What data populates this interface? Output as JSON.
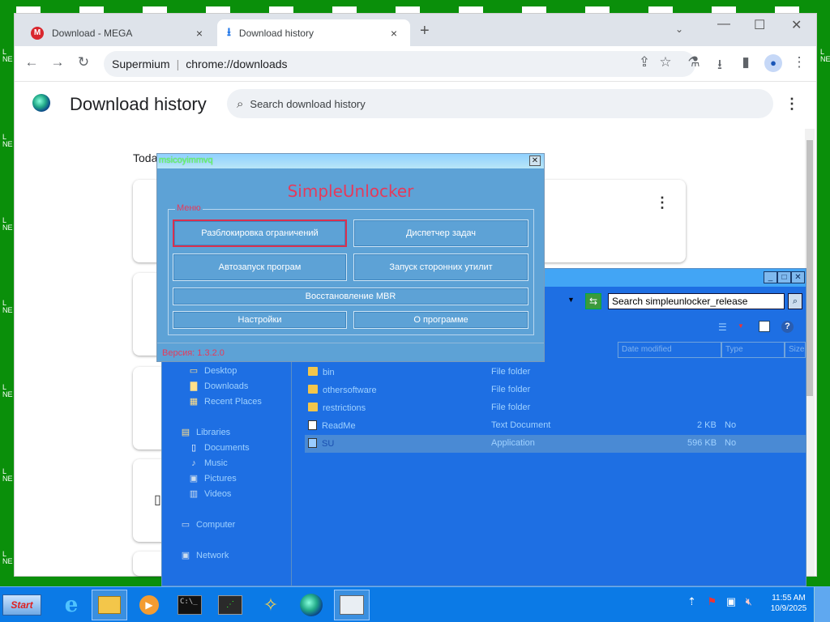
{
  "browser": {
    "tabs": [
      {
        "title": "Download - MEGA",
        "favicon": "mega-icon",
        "active": false
      },
      {
        "title": "Download history",
        "favicon": "download-icon",
        "active": true
      }
    ],
    "new_tab_symbol": "+",
    "tab_close_symbol": "×",
    "omnibox": {
      "site": "Supermium",
      "url": "chrome://downloads"
    },
    "window_controls": [
      "—",
      "☐",
      "✕"
    ]
  },
  "downloads_page": {
    "title": "Download history",
    "search_placeholder": "Search download history",
    "date_group": "Toda",
    "cards_count": 5
  },
  "simpleunlocker": {
    "window_title": "msicoyimmvq",
    "app_title": "SimpleUnlocker",
    "group_label": "Меню",
    "buttons": {
      "unlock_restrictions": "Разблокировка ограничений",
      "task_manager": "Диспетчер задач",
      "autorun": "Автозапуск програм",
      "third_party": "Запуск сторонних утилит",
      "mbr_restore": "Восстановление MBR",
      "settings": "Настройки",
      "about": "О программе"
    },
    "version": "Версия: 1.3.2.0"
  },
  "explorer": {
    "search_text": "Search simpleunlocker_release",
    "columns": [
      "Date modified",
      "Type",
      "Size"
    ],
    "nav": {
      "desktop": "Desktop",
      "downloads": "Downloads",
      "recent": "Recent Places",
      "libraries": "Libraries",
      "documents": "Documents",
      "music": "Music",
      "pictures": "Pictures",
      "videos": "Videos",
      "computer": "Computer",
      "network": "Network"
    },
    "files": [
      {
        "name": "bin",
        "type": "File folder",
        "size": "",
        "extra": "",
        "icon": "folder"
      },
      {
        "name": "othersoftware",
        "type": "File folder",
        "size": "",
        "extra": "",
        "icon": "folder"
      },
      {
        "name": "restrictions",
        "type": "File folder",
        "size": "",
        "extra": "",
        "icon": "folder"
      },
      {
        "name": "ReadMe",
        "type": "Text Document",
        "size": "2 KB",
        "extra": "No",
        "icon": "doc"
      },
      {
        "name": "SU",
        "type": "Application",
        "size": "596 KB",
        "extra": "No",
        "icon": "app"
      }
    ]
  },
  "taskbar": {
    "start_label": "Start",
    "time": "11:55 AM",
    "date": "10/9/2025"
  },
  "colors": {
    "desktop_bg": "#0a8f0a",
    "taskbar": "#0b7ae6",
    "dialog_bg": "#5da2d6",
    "dialog_accent": "#e53a5b",
    "explorer_bg": "#1e6fe3"
  }
}
